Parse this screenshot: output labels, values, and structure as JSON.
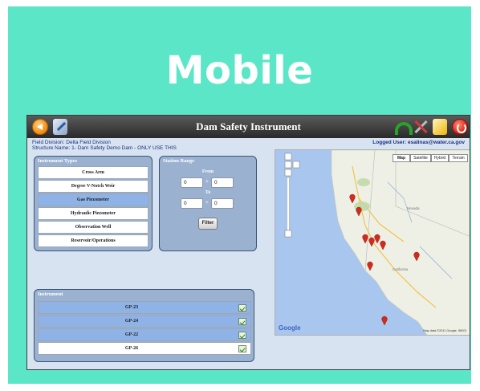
{
  "tile": {
    "heading": "Mobile",
    "background": "#5ce6c8"
  },
  "app": {
    "title": "Dam Safety Instrument",
    "field_division": "Field Division:  Delta Field Division",
    "structure_name": "Structure Name:  1- Dam Safety Demo Dam - ONLY USE THIS",
    "logged_user": "Logged User:  esalinas@water.ca.gov",
    "toolbar_icons": [
      "back-icon",
      "edit-icon",
      "undo-icon",
      "tools-icon",
      "settings-icon",
      "power-icon"
    ]
  },
  "instrument_types": {
    "heading": "Instrument Types",
    "items": [
      {
        "label": "Cross Arm",
        "selected": false
      },
      {
        "label": "Degree V-Notch Weir",
        "selected": false
      },
      {
        "label": "Gas Piezometer",
        "selected": true
      },
      {
        "label": "Hydraulic Piezometer",
        "selected": false
      },
      {
        "label": "Observation Well",
        "selected": false
      },
      {
        "label": "Reservoir/Operations",
        "selected": false
      }
    ]
  },
  "station_range": {
    "heading": "Station Range",
    "from_label": "From",
    "to_label": "To",
    "from_a": "0",
    "from_b": "0",
    "to_a": "0",
    "to_b": "0",
    "plus": "+",
    "filter_label": "Filter"
  },
  "map": {
    "types": [
      "Map",
      "Satellite",
      "Hybrid",
      "Terrain"
    ],
    "selected_type": "Map",
    "attribution": "Map data ©2011 Google, INEGI",
    "google_logo": "Google",
    "markers_count": 9,
    "marker_color": "#d42a1e"
  },
  "instruments": {
    "heading": "Instrument",
    "items": [
      {
        "name": "GP-23",
        "highlight": true
      },
      {
        "name": "GP-24",
        "highlight": true
      },
      {
        "name": "GP-22",
        "highlight": true
      },
      {
        "name": "GP-26",
        "highlight": false
      }
    ]
  }
}
